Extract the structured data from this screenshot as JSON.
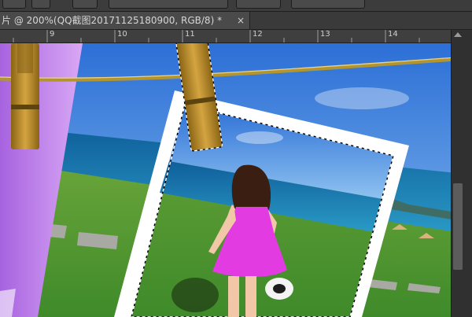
{
  "document_tab": {
    "title": "片 @ 200%(QQ截图20171125180900, RGB/8) *",
    "close_glyph": "×"
  },
  "ruler": {
    "labels": [
      "9",
      "10",
      "11",
      "12",
      "13",
      "14"
    ]
  }
}
